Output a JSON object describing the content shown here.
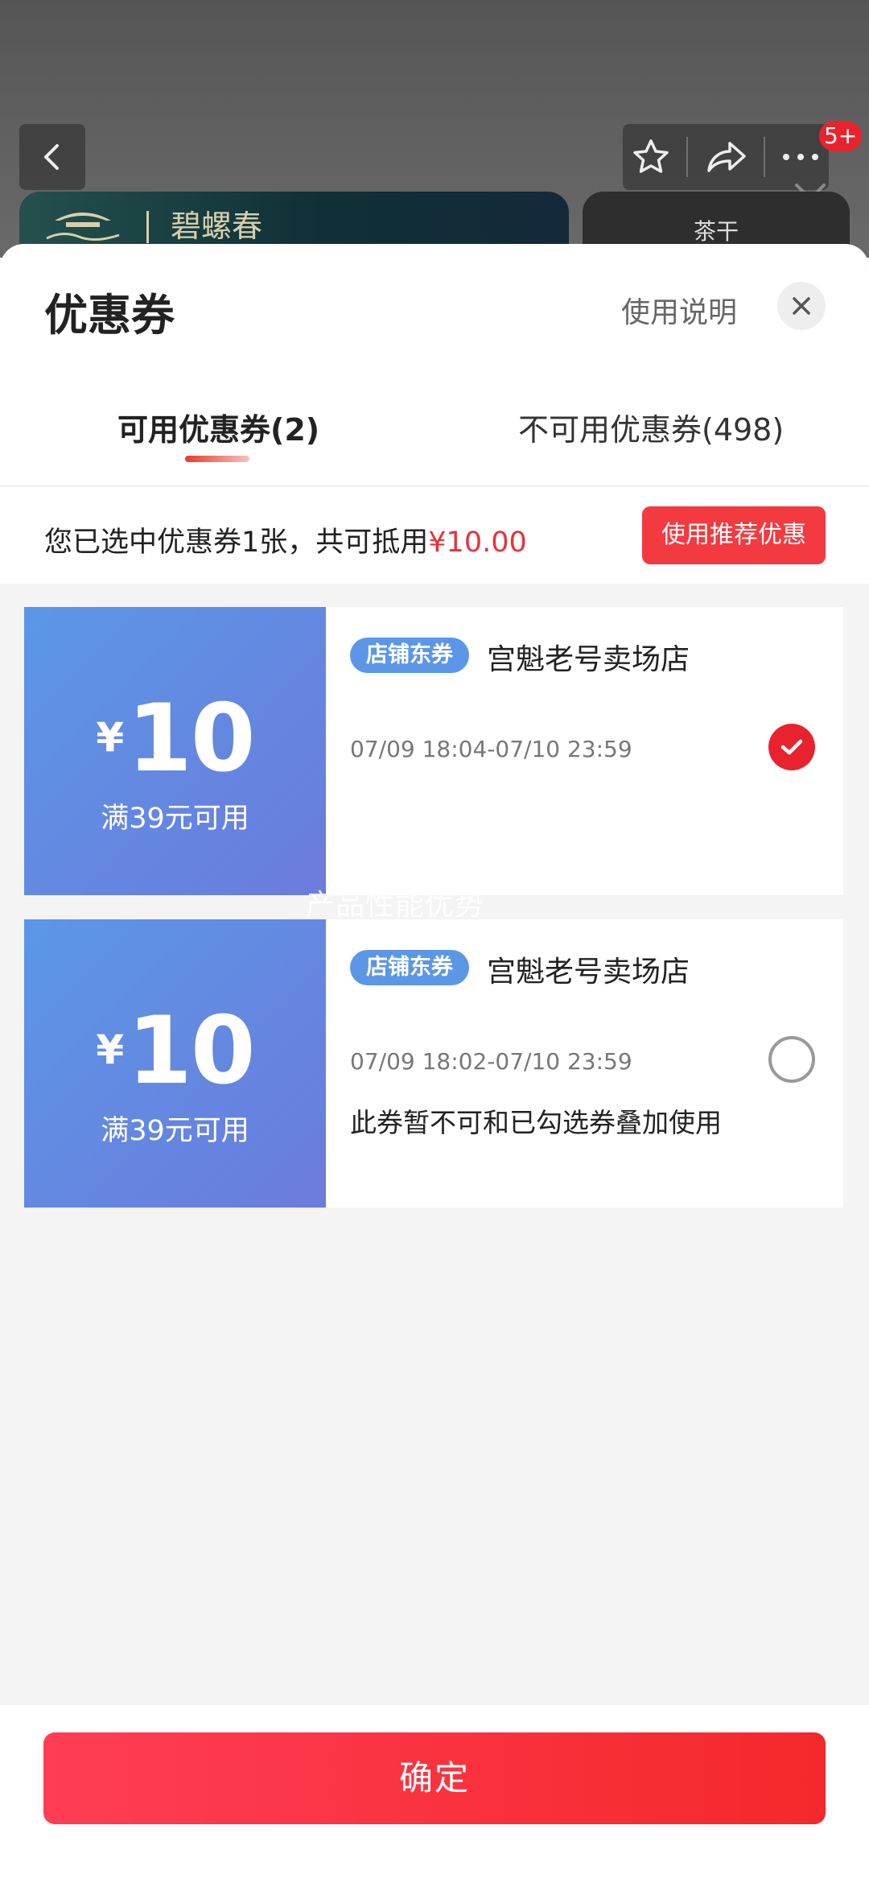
{
  "background": {
    "badge": "5+",
    "banner_name": "碧螺春",
    "side_card_text": "茶干"
  },
  "sheet": {
    "title": "优惠券",
    "help_link": "使用说明"
  },
  "tabs": [
    {
      "label": "可用优惠券(2)",
      "active": true
    },
    {
      "label": "不可用优惠券(498)",
      "active": false
    }
  ],
  "summary": {
    "text": "您已选中优惠券1张，共可抵用",
    "amount": "¥10.00",
    "recommend_label": "使用推荐优惠"
  },
  "coupons": [
    {
      "currency": "¥",
      "amount": "10",
      "condition": "满39元可用",
      "tag": "店铺东券",
      "shop": "宫魁老号卖场店",
      "validity": "07/09 18:04-07/10 23:59",
      "note": "",
      "selected": true
    },
    {
      "currency": "¥",
      "amount": "10",
      "condition": "满39元可用",
      "tag": "店铺东券",
      "shop": "宫魁老号卖场店",
      "validity": "07/09 18:02-07/10 23:59",
      "note": "此券暂不可和已勾选券叠加使用",
      "selected": false
    }
  ],
  "watermark": "产品性能优势",
  "footer": {
    "confirm_label": "确定"
  },
  "colors": {
    "accent_red": "#f33a40",
    "coupon_blue": "#5b97e6"
  }
}
